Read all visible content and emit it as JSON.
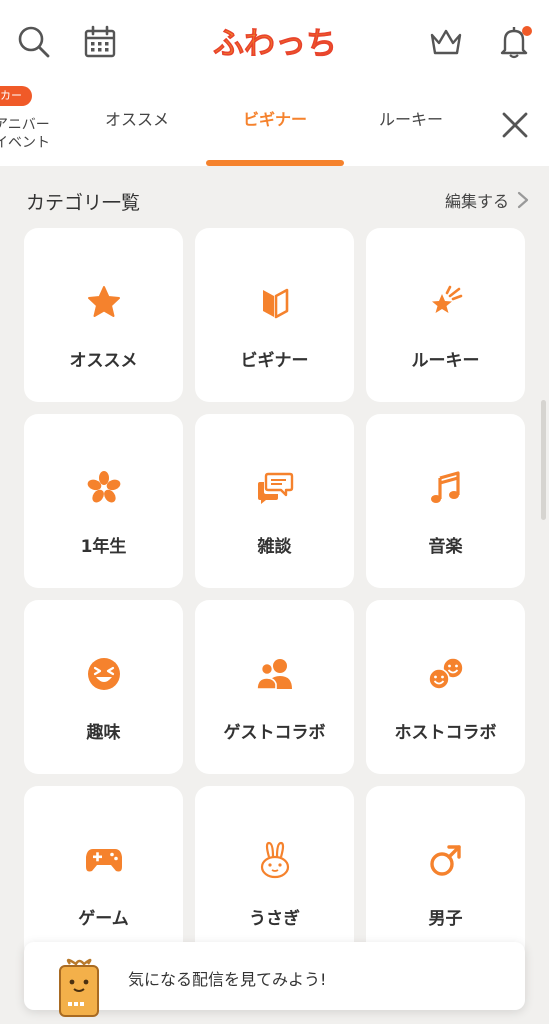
{
  "header": {
    "logo_text": "ふわっち",
    "search_icon": "search-icon",
    "calendar_icon": "calendar-icon",
    "crown_icon": "crown-icon",
    "bell_icon": "bell-icon",
    "notification_dot_color": "#f05a28"
  },
  "tabs": {
    "event_badge": "カー",
    "event_line1": "アニバー",
    "event_line2": "イベント",
    "items": [
      {
        "label": "オススメ",
        "active": false
      },
      {
        "label": "ビギナー",
        "active": true
      },
      {
        "label": "ルーキー",
        "active": false
      }
    ],
    "close_icon": "close-icon",
    "accent_color": "#f5822d"
  },
  "categories": {
    "title": "カテゴリ一覧",
    "edit_label": "編集する",
    "items": [
      {
        "label": "オススメ",
        "icon": "star-icon"
      },
      {
        "label": "ビギナー",
        "icon": "beginner-mark-icon"
      },
      {
        "label": "ルーキー",
        "icon": "rookie-star-icon"
      },
      {
        "label": "1年生",
        "icon": "sakura-icon"
      },
      {
        "label": "雑談",
        "icon": "chat-bubbles-icon"
      },
      {
        "label": "音楽",
        "icon": "music-note-icon"
      },
      {
        "label": "趣味",
        "icon": "laughing-face-icon"
      },
      {
        "label": "ゲストコラボ",
        "icon": "people-icon"
      },
      {
        "label": "ホストコラボ",
        "icon": "smiley-pair-icon"
      },
      {
        "label": "ゲーム",
        "icon": "gamepad-icon"
      },
      {
        "label": "うさぎ",
        "icon": "rabbit-icon"
      },
      {
        "label": "男子",
        "icon": "male-symbol-icon"
      }
    ]
  },
  "toast": {
    "message": "気になる配信を見てみよう!",
    "icon": "gift-mascot-icon"
  }
}
